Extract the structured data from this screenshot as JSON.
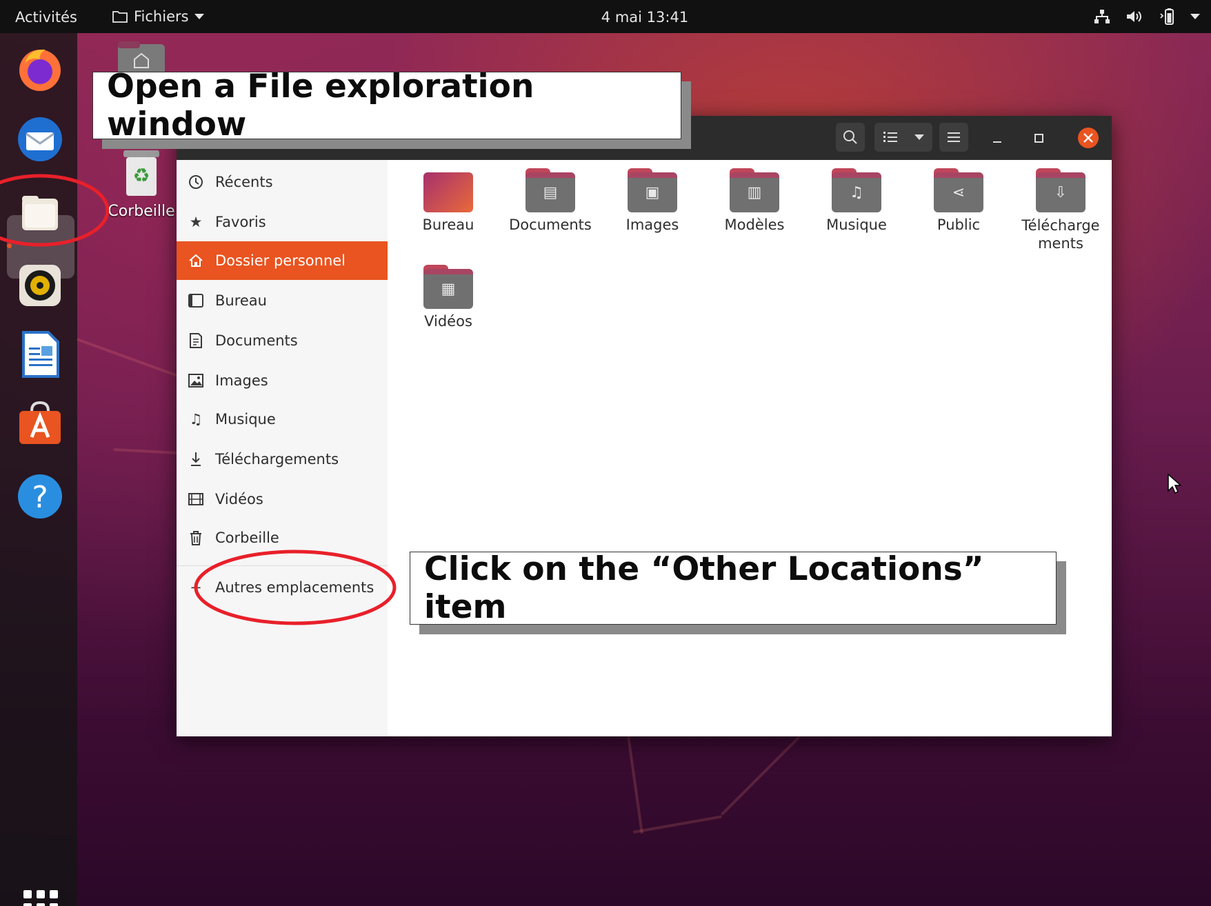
{
  "topbar": {
    "activities": "Activités",
    "app_menu": "Fichiers",
    "clock": "4 mai  13:41"
  },
  "desktop": {
    "trash_label": "Corbeille"
  },
  "sidebar": {
    "items": [
      {
        "label": "Récents",
        "icon": "clock-icon"
      },
      {
        "label": "Favoris",
        "icon": "star-icon"
      },
      {
        "label": "Dossier personnel",
        "icon": "home-icon"
      },
      {
        "label": "Bureau",
        "icon": "desktop-icon"
      },
      {
        "label": "Documents",
        "icon": "document-icon"
      },
      {
        "label": "Images",
        "icon": "image-icon"
      },
      {
        "label": "Musique",
        "icon": "music-icon"
      },
      {
        "label": "Téléchargements",
        "icon": "download-icon"
      },
      {
        "label": "Vidéos",
        "icon": "video-icon"
      },
      {
        "label": "Corbeille",
        "icon": "trash-icon"
      }
    ],
    "other_locations": "Autres emplacements"
  },
  "folders": [
    {
      "label": "Bureau",
      "icon": "desktop-folder-icon"
    },
    {
      "label": "Documents",
      "icon": "documents-folder-icon"
    },
    {
      "label": "Images",
      "icon": "images-folder-icon"
    },
    {
      "label": "Modèles",
      "icon": "templates-folder-icon"
    },
    {
      "label": "Musique",
      "icon": "music-folder-icon"
    },
    {
      "label": "Public",
      "icon": "public-folder-icon"
    },
    {
      "label": "Télécharge\nments",
      "icon": "downloads-folder-icon"
    },
    {
      "label": "Vidéos",
      "icon": "videos-folder-icon"
    }
  ],
  "callouts": {
    "step1": "Open a File exploration window",
    "step2": "Click on the “Other Locations” item"
  },
  "colors": {
    "accent": "#e95420",
    "annotation": "#e8202a"
  }
}
